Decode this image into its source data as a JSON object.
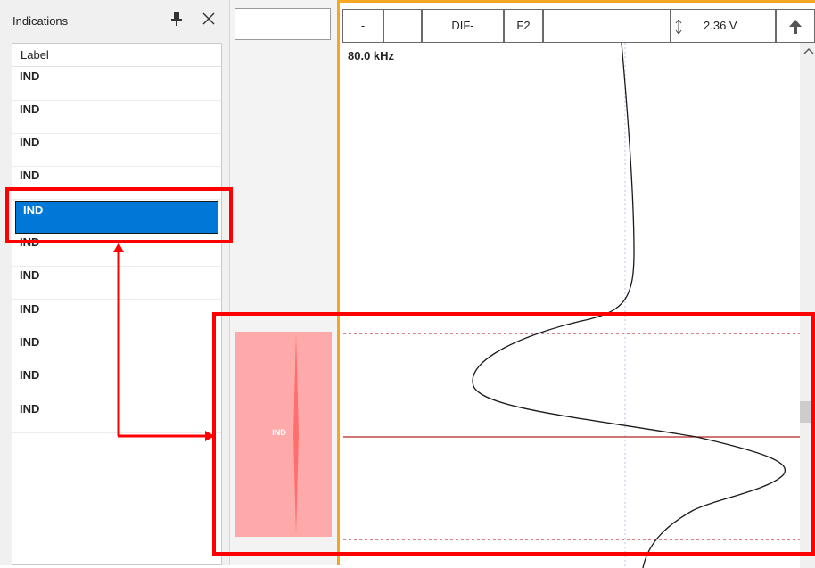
{
  "panel": {
    "title": "Indications",
    "list_header": "Label",
    "items": [
      "IND",
      "IND",
      "IND",
      "IND",
      "IND",
      "IND",
      "IND",
      "IND",
      "IND",
      "IND",
      "IND"
    ],
    "selected_index": 4
  },
  "strip": {
    "indication_label": "IND"
  },
  "toolbar": {
    "field1": "-",
    "field2": "",
    "mode": "DIF-",
    "filter": "F2",
    "field5": "",
    "voltage": "2.36 V"
  },
  "signal": {
    "frequency": "80.0 kHz"
  },
  "colors": {
    "selection": "#0078d7",
    "highlight": "#ff0000",
    "view_border": "#f5a623",
    "indication_fill": "#ffaaaa"
  },
  "icons": [
    "pin-icon",
    "close-icon",
    "vertical-arrows-icon",
    "arrow-up-icon",
    "scroll-up-icon"
  ]
}
